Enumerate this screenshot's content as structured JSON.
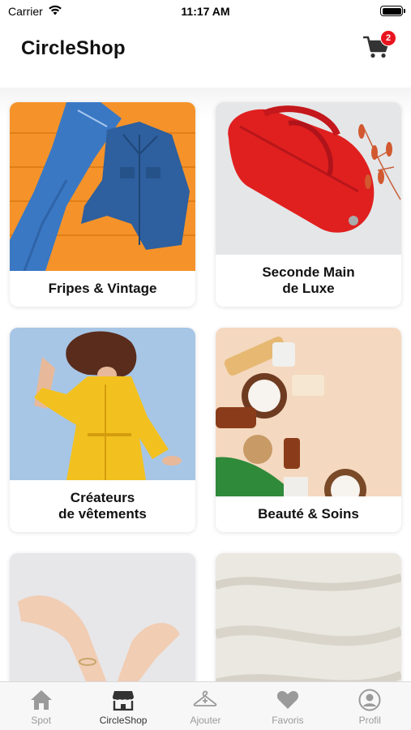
{
  "status_bar": {
    "carrier": "Carrier",
    "time": "11:17 AM",
    "battery_level": 1.0
  },
  "header": {
    "title": "CircleShop",
    "cart_count": "2"
  },
  "colors": {
    "badge": "#e8141e",
    "tab_active": "#333333",
    "tab_inactive": "#9a9a9a"
  },
  "categories": [
    {
      "label": "Fripes & Vintage",
      "icon": "denim-jeans-jacket-image"
    },
    {
      "label": "Seconde Main\nde Luxe",
      "icon": "red-handbag-image"
    },
    {
      "label": "Créateurs\nde vêtements",
      "icon": "yellow-trench-coat-image"
    },
    {
      "label": "Beauté & Soins",
      "icon": "cosmetics-coconut-image"
    },
    {
      "label": "",
      "icon": "hands-bracelet-image"
    },
    {
      "label": "",
      "icon": "linen-fabric-image"
    }
  ],
  "tabs": [
    {
      "label": "Spot",
      "icon": "home-icon",
      "active": false
    },
    {
      "label": "CircleShop",
      "icon": "store-icon",
      "active": true
    },
    {
      "label": "Ajouter",
      "icon": "hanger-plus-icon",
      "active": false
    },
    {
      "label": "Favoris",
      "icon": "heart-icon",
      "active": false
    },
    {
      "label": "Profil",
      "icon": "user-circle-icon",
      "active": false
    }
  ]
}
